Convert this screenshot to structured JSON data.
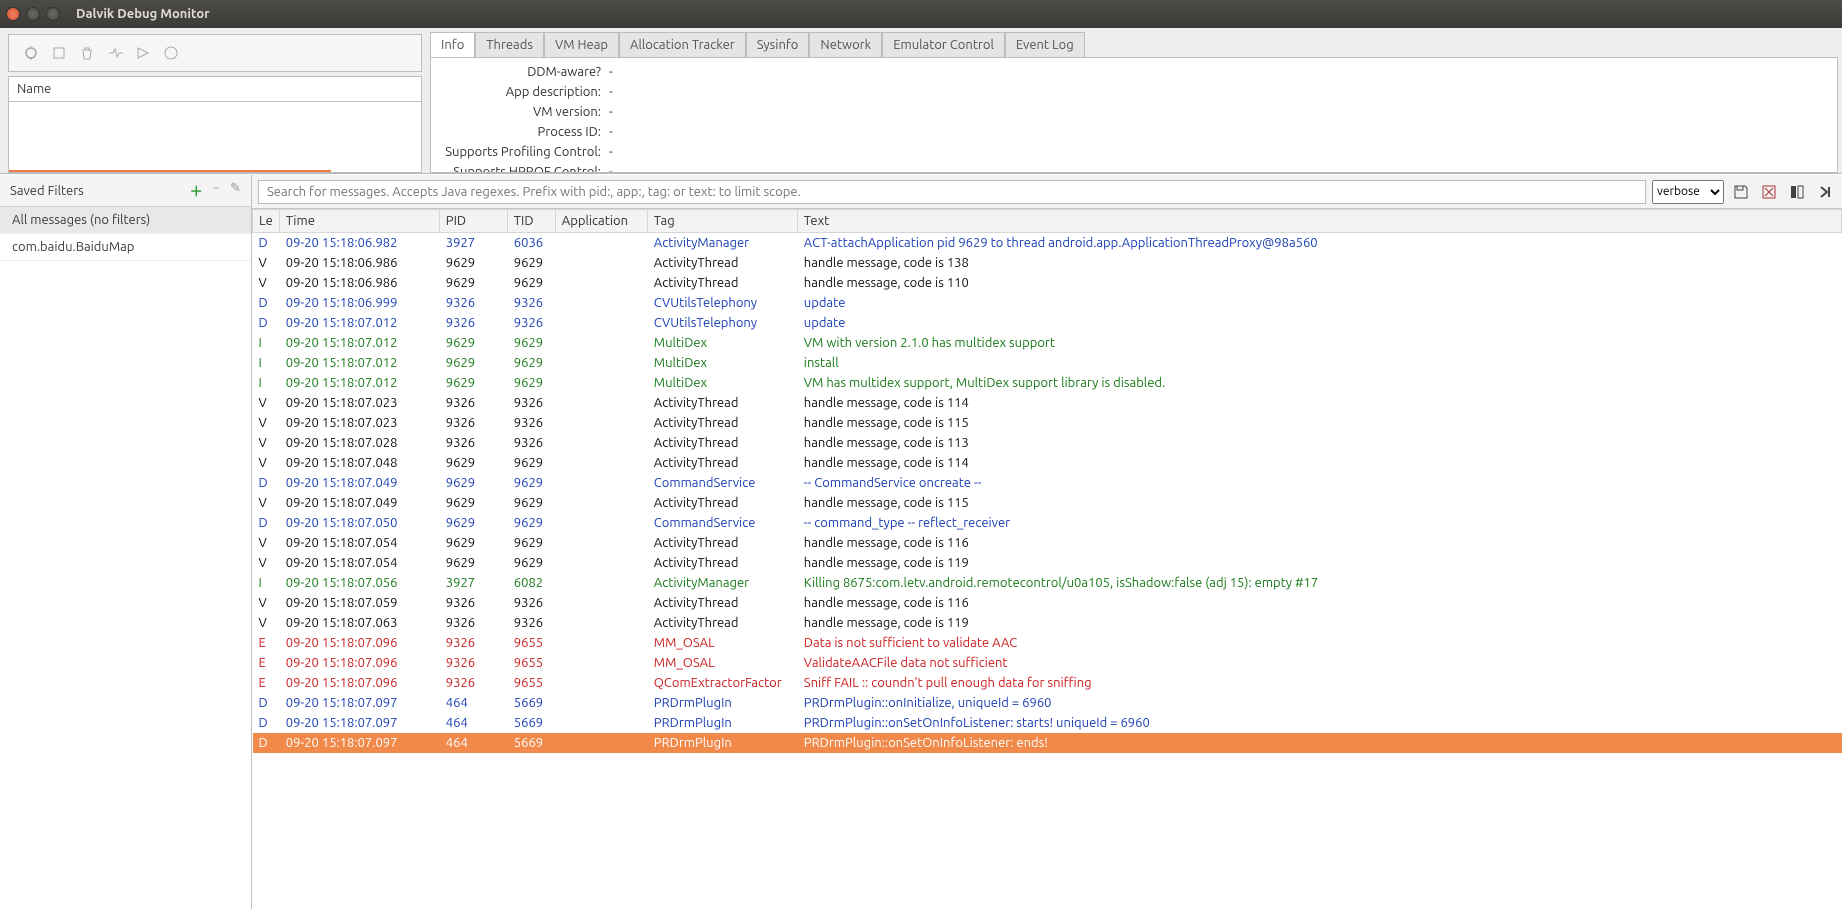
{
  "window_title": "Dalvik Debug Monitor",
  "top_tabs": [
    "Info",
    "Threads",
    "VM Heap",
    "Allocation Tracker",
    "Sysinfo",
    "Network",
    "Emulator Control",
    "Event Log"
  ],
  "active_tab": "Info",
  "name_header": "Name",
  "info": [
    {
      "label": "DDM-aware?",
      "value": "-"
    },
    {
      "label": "App description:",
      "value": "-"
    },
    {
      "label": "VM version:",
      "value": "-"
    },
    {
      "label": "Process ID:",
      "value": "-"
    },
    {
      "label": "Supports Profiling Control:",
      "value": "-"
    },
    {
      "label": "Supports HPROF Control:",
      "value": "-"
    }
  ],
  "filters_header": "Saved Filters",
  "filters": [
    {
      "label": "All messages (no filters)",
      "selected": true
    },
    {
      "label": "com.baidu.BaiduMap",
      "selected": false
    }
  ],
  "search_placeholder": "Search for messages. Accepts Java regexes. Prefix with pid:, app:, tag: or text: to limit scope.",
  "level_value": "verbose",
  "log_headers": [
    "Le",
    "Time",
    "PID",
    "TID",
    "Application",
    "Tag",
    "Text"
  ],
  "log_rows": [
    {
      "lv": "D",
      "time": "09-20 15:18:06.982",
      "pid": "3927",
      "tid": "6036",
      "app": "",
      "tag": "ActivityManager",
      "text": "ACT-attachApplication pid 9629 to thread android.app.ApplicationThreadProxy@98a560"
    },
    {
      "lv": "V",
      "time": "09-20 15:18:06.986",
      "pid": "9629",
      "tid": "9629",
      "app": "",
      "tag": "ActivityThread",
      "text": "handle message, code is 138"
    },
    {
      "lv": "V",
      "time": "09-20 15:18:06.986",
      "pid": "9629",
      "tid": "9629",
      "app": "",
      "tag": "ActivityThread",
      "text": "handle message, code is 110"
    },
    {
      "lv": "D",
      "time": "09-20 15:18:06.999",
      "pid": "9326",
      "tid": "9326",
      "app": "",
      "tag": "CVUtilsTelephony",
      "text": "update"
    },
    {
      "lv": "D",
      "time": "09-20 15:18:07.012",
      "pid": "9326",
      "tid": "9326",
      "app": "",
      "tag": "CVUtilsTelephony",
      "text": "update"
    },
    {
      "lv": "I",
      "time": "09-20 15:18:07.012",
      "pid": "9629",
      "tid": "9629",
      "app": "",
      "tag": "MultiDex",
      "text": "VM with version 2.1.0 has multidex support"
    },
    {
      "lv": "I",
      "time": "09-20 15:18:07.012",
      "pid": "9629",
      "tid": "9629",
      "app": "",
      "tag": "MultiDex",
      "text": "install"
    },
    {
      "lv": "I",
      "time": "09-20 15:18:07.012",
      "pid": "9629",
      "tid": "9629",
      "app": "",
      "tag": "MultiDex",
      "text": "VM has multidex support, MultiDex support library is disabled."
    },
    {
      "lv": "V",
      "time": "09-20 15:18:07.023",
      "pid": "9326",
      "tid": "9326",
      "app": "",
      "tag": "ActivityThread",
      "text": "handle message, code is 114"
    },
    {
      "lv": "V",
      "time": "09-20 15:18:07.023",
      "pid": "9326",
      "tid": "9326",
      "app": "",
      "tag": "ActivityThread",
      "text": "handle message, code is 115"
    },
    {
      "lv": "V",
      "time": "09-20 15:18:07.028",
      "pid": "9326",
      "tid": "9326",
      "app": "",
      "tag": "ActivityThread",
      "text": "handle message, code is 113"
    },
    {
      "lv": "V",
      "time": "09-20 15:18:07.048",
      "pid": "9629",
      "tid": "9629",
      "app": "",
      "tag": "ActivityThread",
      "text": "handle message, code is 114"
    },
    {
      "lv": "D",
      "time": "09-20 15:18:07.049",
      "pid": "9629",
      "tid": "9629",
      "app": "",
      "tag": "CommandService",
      "text": "-- CommandService oncreate --"
    },
    {
      "lv": "V",
      "time": "09-20 15:18:07.049",
      "pid": "9629",
      "tid": "9629",
      "app": "",
      "tag": "ActivityThread",
      "text": "handle message, code is 115"
    },
    {
      "lv": "D",
      "time": "09-20 15:18:07.050",
      "pid": "9629",
      "tid": "9629",
      "app": "",
      "tag": "CommandService",
      "text": "-- command_type -- reflect_receiver"
    },
    {
      "lv": "V",
      "time": "09-20 15:18:07.054",
      "pid": "9629",
      "tid": "9629",
      "app": "",
      "tag": "ActivityThread",
      "text": "handle message, code is 116"
    },
    {
      "lv": "V",
      "time": "09-20 15:18:07.054",
      "pid": "9629",
      "tid": "9629",
      "app": "",
      "tag": "ActivityThread",
      "text": "handle message, code is 119"
    },
    {
      "lv": "I",
      "time": "09-20 15:18:07.056",
      "pid": "3927",
      "tid": "6082",
      "app": "",
      "tag": "ActivityManager",
      "text": "Killing 8675:com.letv.android.remotecontrol/u0a105, isShadow:false (adj 15): empty #17"
    },
    {
      "lv": "V",
      "time": "09-20 15:18:07.059",
      "pid": "9326",
      "tid": "9326",
      "app": "",
      "tag": "ActivityThread",
      "text": "handle message, code is 116"
    },
    {
      "lv": "V",
      "time": "09-20 15:18:07.063",
      "pid": "9326",
      "tid": "9326",
      "app": "",
      "tag": "ActivityThread",
      "text": "handle message, code is 119"
    },
    {
      "lv": "E",
      "time": "09-20 15:18:07.096",
      "pid": "9326",
      "tid": "9655",
      "app": "",
      "tag": "MM_OSAL",
      "text": "Data is not sufficient to validate AAC"
    },
    {
      "lv": "E",
      "time": "09-20 15:18:07.096",
      "pid": "9326",
      "tid": "9655",
      "app": "",
      "tag": "MM_OSAL",
      "text": "ValidateAACFile data not sufficient"
    },
    {
      "lv": "E",
      "time": "09-20 15:18:07.096",
      "pid": "9326",
      "tid": "9655",
      "app": "",
      "tag": "QComExtractorFactor",
      "text": "Sniff FAIL :: coundn't pull enough data for sniffing"
    },
    {
      "lv": "D",
      "time": "09-20 15:18:07.097",
      "pid": "464",
      "tid": "5669",
      "app": "",
      "tag": "PRDrmPlugIn",
      "text": "PRDrmPlugin::onInitialize, uniqueId = 6960"
    },
    {
      "lv": "D",
      "time": "09-20 15:18:07.097",
      "pid": "464",
      "tid": "5669",
      "app": "",
      "tag": "PRDrmPlugIn",
      "text": "PRDrmPlugin::onSetOnInfoListener: starts! uniqueId = 6960"
    },
    {
      "lv": "D",
      "time": "09-20 15:18:07.097",
      "pid": "464",
      "tid": "5669",
      "app": "",
      "tag": "PRDrmPlugIn",
      "text": "PRDrmPlugin::onSetOnInfoListener: ends!",
      "hl": true
    }
  ]
}
